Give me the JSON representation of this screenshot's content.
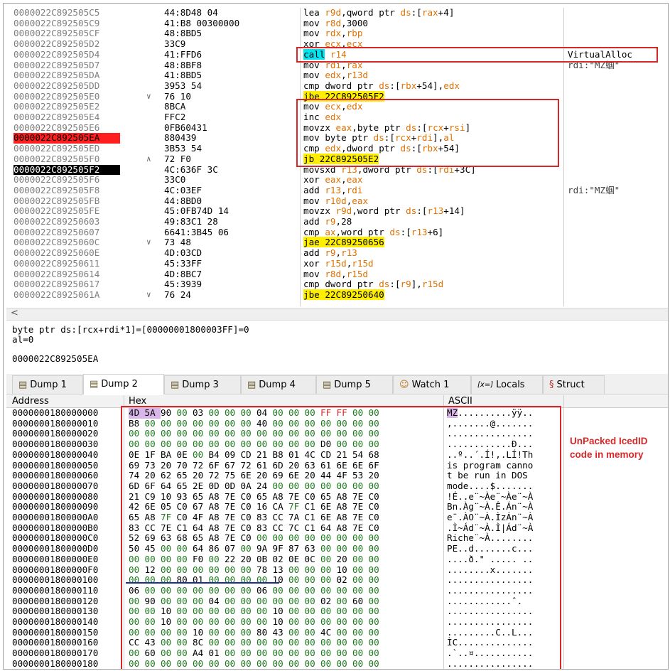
{
  "colors": {
    "addr_grey": "#7f7f7f",
    "eip_red": "#ff1f1f",
    "current_black": "#000000",
    "register_orange": "#e07000",
    "jump_yellow": "#ffee00",
    "call_cyan": "#00e5ef",
    "annotation_red": "#d62828",
    "mz_purple": "#d9b6ea",
    "hex_green": "#1e7a1e",
    "hex_red": "#d62828"
  },
  "disasm": {
    "rows": [
      {
        "addr": "0000022C892505C5",
        "jmp": "",
        "bytes": "44:8D48 04",
        "ins": [
          [
            "lea ",
            ""
          ],
          [
            "r9d",
            ""
          ],
          [
            ",qword ptr ",
            ""
          ],
          [
            "ds",
            ""
          ],
          [
            ":[",
            ""
          ],
          [
            "rax",
            ""
          ],
          [
            "+4]",
            ""
          ]
        ],
        "comment": ""
      },
      {
        "addr": "0000022C892505C9",
        "jmp": "",
        "bytes": "41:B8 00300000",
        "ins": [
          [
            "mov r8d,3000",
            ""
          ]
        ],
        "comment": ""
      },
      {
        "addr": "0000022C892505CF",
        "jmp": "",
        "bytes": "48:8BD5",
        "ins": [
          [
            "mov rdx,rbp",
            ""
          ]
        ],
        "comment": ""
      },
      {
        "addr": "0000022C892505D2",
        "jmp": "",
        "bytes": "33C9",
        "ins": [
          [
            "xor ecx,ecx",
            ""
          ]
        ],
        "comment": ""
      },
      {
        "addr": "0000022C892505D4",
        "jmp": "",
        "bytes": "41:FFD6",
        "ins": [
          [
            "call",
            "cyan"
          ],
          [
            " r14",
            ""
          ]
        ],
        "comment": "VirtualAlloc"
      },
      {
        "addr": "0000022C892505D7",
        "jmp": "",
        "bytes": "48:8BF8",
        "ins": [
          [
            "mov rdi,rax",
            ""
          ]
        ],
        "comment": "rdi:\"MZ蝈\""
      },
      {
        "addr": "0000022C892505DA",
        "jmp": "",
        "bytes": "41:8BD5",
        "ins": [
          [
            "mov edx,r13d",
            ""
          ]
        ],
        "comment": ""
      },
      {
        "addr": "0000022C892505DD",
        "jmp": "",
        "bytes": "3953 54",
        "ins": [
          [
            "cmp dword ptr ds:[rbx+54],edx",
            ""
          ]
        ],
        "comment": ""
      },
      {
        "addr": "0000022C892505E0",
        "jmp": "∨",
        "bytes": "76 10",
        "ins": [
          [
            "jbe",
            "yel"
          ],
          [
            " 22C892505F2",
            "yel"
          ]
        ],
        "comment": ""
      },
      {
        "addr": "0000022C892505E2",
        "jmp": "",
        "bytes": "8BCA",
        "ins": [
          [
            "mov ecx,edx",
            ""
          ]
        ],
        "comment": ""
      },
      {
        "addr": "0000022C892505E4",
        "jmp": "",
        "bytes": "FFC2",
        "ins": [
          [
            "inc edx",
            ""
          ]
        ],
        "comment": ""
      },
      {
        "addr": "0000022C892505E6",
        "jmp": "",
        "bytes": "0FB60431",
        "ins": [
          [
            "movzx eax,byte ptr ds:[rcx+rsi]",
            ""
          ]
        ],
        "comment": ""
      },
      {
        "addr": "0000022C892505EA",
        "jmp": "",
        "bytes": "880439",
        "ins": [
          [
            "mov byte ptr ds:[rcx+rdi],al",
            ""
          ]
        ],
        "comment": "",
        "addr_style": "red"
      },
      {
        "addr": "0000022C892505ED",
        "jmp": "",
        "bytes": "3B53 54",
        "ins": [
          [
            "cmp edx,dword ptr ds:[rbx+54]",
            ""
          ]
        ],
        "comment": ""
      },
      {
        "addr": "0000022C892505F0",
        "jmp": "∧",
        "bytes": "72 F0",
        "ins": [
          [
            "jb",
            "yel"
          ],
          [
            " 22C892505E2",
            "yel"
          ]
        ],
        "comment": ""
      },
      {
        "addr": "0000022C892505F2",
        "jmp": "",
        "bytes": "4C:636F 3C",
        "ins": [
          [
            "movsxd r13,dword ptr ds:[rdi+3C]",
            ""
          ]
        ],
        "comment": "",
        "addr_style": "black"
      },
      {
        "addr": "0000022C892505F6",
        "jmp": "",
        "bytes": "33C0",
        "ins": [
          [
            "xor eax,eax",
            ""
          ]
        ],
        "comment": ""
      },
      {
        "addr": "0000022C892505F8",
        "jmp": "",
        "bytes": "4C:03EF",
        "ins": [
          [
            "add r13,rdi",
            ""
          ]
        ],
        "comment": "rdi:\"MZ蝈\""
      },
      {
        "addr": "0000022C892505FB",
        "jmp": "",
        "bytes": "44:8BD0",
        "ins": [
          [
            "mov r10d,eax",
            ""
          ]
        ],
        "comment": ""
      },
      {
        "addr": "0000022C892505FE",
        "jmp": "",
        "bytes": "45:0FB74D 14",
        "ins": [
          [
            "movzx r9d,word ptr ds:[r13+14]",
            ""
          ]
        ],
        "comment": ""
      },
      {
        "addr": "0000022C89250603",
        "jmp": "",
        "bytes": "49:83C1 28",
        "ins": [
          [
            "add r9,28",
            ""
          ]
        ],
        "comment": ""
      },
      {
        "addr": "0000022C89250607",
        "jmp": "",
        "bytes": "6641:3B45 06",
        "ins": [
          [
            "cmp ax,word ptr ds:[r13+6]",
            ""
          ]
        ],
        "comment": ""
      },
      {
        "addr": "0000022C8925060C",
        "jmp": "∨",
        "bytes": "73 48",
        "ins": [
          [
            "jae",
            "yel"
          ],
          [
            " 22C89250656",
            "yel"
          ]
        ],
        "comment": ""
      },
      {
        "addr": "0000022C8925060E",
        "jmp": "",
        "bytes": "4D:03CD",
        "ins": [
          [
            "add r9,r13",
            ""
          ]
        ],
        "comment": ""
      },
      {
        "addr": "0000022C89250611",
        "jmp": "",
        "bytes": "45:33FF",
        "ins": [
          [
            "xor r15d,r15d",
            ""
          ]
        ],
        "comment": ""
      },
      {
        "addr": "0000022C89250614",
        "jmp": "",
        "bytes": "4D:8BC7",
        "ins": [
          [
            "mov r8d,r15d",
            ""
          ]
        ],
        "comment": ""
      },
      {
        "addr": "0000022C89250617",
        "jmp": "",
        "bytes": "45:3939",
        "ins": [
          [
            "cmp dword ptr ds:[r9],r15d",
            ""
          ]
        ],
        "comment": ""
      },
      {
        "addr": "0000022C8925061A",
        "jmp": "∨",
        "bytes": "76 24",
        "ins": [
          [
            "jbe",
            "yel"
          ],
          [
            " 22C89250640",
            "yel"
          ]
        ],
        "comment": ""
      }
    ]
  },
  "scroll": {
    "left_arrow": "<"
  },
  "info": {
    "line1": "byte ptr ds:[rcx+rdi*1]=[00000001800003FF]=0",
    "line2": "al=0",
    "line3": "0000022C892505EA"
  },
  "tabs": [
    {
      "label": "Dump 1",
      "icon": "dump-icon"
    },
    {
      "label": "Dump 2",
      "icon": "dump-icon"
    },
    {
      "label": "Dump 3",
      "icon": "dump-icon"
    },
    {
      "label": "Dump 4",
      "icon": "dump-icon"
    },
    {
      "label": "Dump 5",
      "icon": "dump-icon"
    },
    {
      "label": "Watch 1",
      "icon": "watch-icon"
    },
    {
      "label": "Locals",
      "icon": "locals-icon",
      "icon_text": "[x=]"
    },
    {
      "label": "Struct",
      "icon": "struct-icon"
    }
  ],
  "active_tab": "Dump 2",
  "dump": {
    "headers": {
      "address": "Address",
      "hex": "Hex",
      "ascii": "ASCII"
    },
    "rows": [
      {
        "addr": "0000000180000000",
        "hex": [
          "4D",
          "5A",
          "90",
          "00",
          "03",
          "00",
          "00",
          "00",
          "04",
          "00",
          "00",
          "00",
          "FF",
          "FF",
          "00",
          "00"
        ],
        "ascii": "MZ..........ÿÿ.."
      },
      {
        "addr": "0000000180000010",
        "hex": [
          "B8",
          "00",
          "00",
          "00",
          "00",
          "00",
          "00",
          "00",
          "40",
          "00",
          "00",
          "00",
          "00",
          "00",
          "00",
          "00"
        ],
        "ascii": ",.......@......."
      },
      {
        "addr": "0000000180000020",
        "hex": [
          "00",
          "00",
          "00",
          "00",
          "00",
          "00",
          "00",
          "00",
          "00",
          "00",
          "00",
          "00",
          "00",
          "00",
          "00",
          "00"
        ],
        "ascii": "................"
      },
      {
        "addr": "0000000180000030",
        "hex": [
          "00",
          "00",
          "00",
          "00",
          "00",
          "00",
          "00",
          "00",
          "00",
          "00",
          "00",
          "00",
          "D0",
          "00",
          "00",
          "00"
        ],
        "ascii": "............Ð..."
      },
      {
        "addr": "0000000180000040",
        "hex": [
          "0E",
          "1F",
          "BA",
          "0E",
          "00",
          "B4",
          "09",
          "CD",
          "21",
          "B8",
          "01",
          "4C",
          "CD",
          "21",
          "54",
          "68"
        ],
        "ascii": "..º..´.Í!,.LÍ!Th"
      },
      {
        "addr": "0000000180000050",
        "hex": [
          "69",
          "73",
          "20",
          "70",
          "72",
          "6F",
          "67",
          "72",
          "61",
          "6D",
          "20",
          "63",
          "61",
          "6E",
          "6E",
          "6F"
        ],
        "ascii": "is program canno"
      },
      {
        "addr": "0000000180000060",
        "hex": [
          "74",
          "20",
          "62",
          "65",
          "20",
          "72",
          "75",
          "6E",
          "20",
          "69",
          "6E",
          "20",
          "44",
          "4F",
          "53",
          "20"
        ],
        "ascii": "t be run in DOS "
      },
      {
        "addr": "0000000180000070",
        "hex": [
          "6D",
          "6F",
          "64",
          "65",
          "2E",
          "0D",
          "0D",
          "0A",
          "24",
          "00",
          "00",
          "00",
          "00",
          "00",
          "00",
          "00"
        ],
        "ascii": "mode....$......."
      },
      {
        "addr": "0000000180000080",
        "hex": [
          "21",
          "C9",
          "10",
          "93",
          "65",
          "A8",
          "7E",
          "C0",
          "65",
          "A8",
          "7E",
          "C0",
          "65",
          "A8",
          "7E",
          "C0"
        ],
        "ascii": "!É..e¨~Àe¨~Àe¨~À"
      },
      {
        "addr": "0000000180000090",
        "hex": [
          "42",
          "6E",
          "05",
          "C0",
          "67",
          "A8",
          "7E",
          "C0",
          "16",
          "CA",
          "7F",
          "C1",
          "6E",
          "A8",
          "7E",
          "C0"
        ],
        "ascii": "Bn.Àg¨~À.Ê.Án¨~À"
      },
      {
        "addr": "00000001800000A0",
        "hex": [
          "65",
          "A8",
          "7F",
          "C0",
          "4F",
          "A8",
          "7E",
          "C0",
          "83",
          "CC",
          "7A",
          "C1",
          "6E",
          "A8",
          "7E",
          "C0"
        ],
        "ascii": "e¨.ÀO¨~À.ÌzÁn¨~À"
      },
      {
        "addr": "00000001800000B0",
        "hex": [
          "83",
          "CC",
          "7E",
          "C1",
          "64",
          "A8",
          "7E",
          "C0",
          "83",
          "CC",
          "7C",
          "C1",
          "64",
          "A8",
          "7E",
          "C0"
        ],
        "ascii": ".Ì~Ád¨~À.Ì|Ád¨~À"
      },
      {
        "addr": "00000001800000C0",
        "hex": [
          "52",
          "69",
          "63",
          "68",
          "65",
          "A8",
          "7E",
          "C0",
          "00",
          "00",
          "00",
          "00",
          "00",
          "00",
          "00",
          "00"
        ],
        "ascii": "Riche¨~À........"
      },
      {
        "addr": "00000001800000D0",
        "hex": [
          "50",
          "45",
          "00",
          "00",
          "64",
          "86",
          "07",
          "00",
          "9A",
          "9F",
          "87",
          "63",
          "00",
          "00",
          "00",
          "00"
        ],
        "ascii": "PE..d.......c..."
      },
      {
        "addr": "00000001800000E0",
        "hex": [
          "00",
          "00",
          "00",
          "00",
          "F0",
          "00",
          "22",
          "20",
          "0B",
          "02",
          "0E",
          "0C",
          "00",
          "20",
          "00",
          "00"
        ],
        "ascii": "....ð.\" ..... .."
      },
      {
        "addr": "00000001800000F0",
        "hex": [
          "00",
          "12",
          "00",
          "00",
          "00",
          "00",
          "00",
          "00",
          "78",
          "13",
          "00",
          "00",
          "00",
          "10",
          "00",
          "00"
        ],
        "ascii": "........x......."
      },
      {
        "addr": "0000000180000100",
        "hex": [
          "00",
          "00",
          "00",
          "80",
          "01",
          "00",
          "00",
          "00",
          "00",
          "10",
          "00",
          "00",
          "00",
          "02",
          "00",
          "00"
        ],
        "ascii": "................"
      },
      {
        "addr": "0000000180000110",
        "hex": [
          "06",
          "00",
          "00",
          "00",
          "00",
          "00",
          "00",
          "00",
          "06",
          "00",
          "00",
          "00",
          "00",
          "00",
          "00",
          "00"
        ],
        "ascii": "................"
      },
      {
        "addr": "0000000180000120",
        "hex": [
          "00",
          "90",
          "00",
          "00",
          "00",
          "04",
          "00",
          "00",
          "00",
          "00",
          "00",
          "00",
          "02",
          "00",
          "60",
          "00"
        ],
        "ascii": "............ˆ."
      },
      {
        "addr": "0000000180000130",
        "hex": [
          "00",
          "00",
          "10",
          "00",
          "00",
          "00",
          "00",
          "00",
          "00",
          "10",
          "00",
          "00",
          "00",
          "00",
          "00",
          "00"
        ],
        "ascii": "................"
      },
      {
        "addr": "0000000180000140",
        "hex": [
          "00",
          "00",
          "10",
          "00",
          "00",
          "00",
          "00",
          "00",
          "00",
          "10",
          "00",
          "00",
          "00",
          "00",
          "00",
          "00"
        ],
        "ascii": "................"
      },
      {
        "addr": "0000000180000150",
        "hex": [
          "00",
          "00",
          "00",
          "00",
          "10",
          "00",
          "00",
          "00",
          "80",
          "43",
          "00",
          "00",
          "4C",
          "00",
          "00",
          "00"
        ],
        "ascii": ".........C..L..."
      },
      {
        "addr": "0000000180000160",
        "hex": [
          "CC",
          "43",
          "00",
          "00",
          "8C",
          "00",
          "00",
          "00",
          "00",
          "00",
          "00",
          "00",
          "00",
          "00",
          "00",
          "00"
        ],
        "ascii": "ÌC.............."
      },
      {
        "addr": "0000000180000170",
        "hex": [
          "00",
          "60",
          "00",
          "00",
          "A4",
          "01",
          "00",
          "00",
          "00",
          "00",
          "00",
          "00",
          "00",
          "00",
          "00",
          "00"
        ],
        "ascii": ".`..¤..........."
      },
      {
        "addr": "0000000180000180",
        "hex": [
          "00",
          "00",
          "00",
          "00",
          "00",
          "00",
          "00",
          "00",
          "00",
          "00",
          "00",
          "00",
          "00",
          "00",
          "00",
          "00"
        ],
        "ascii": "................"
      }
    ]
  },
  "annotation": {
    "text_line1": "UnPacked IcedID",
    "text_line2": "code in memory"
  }
}
